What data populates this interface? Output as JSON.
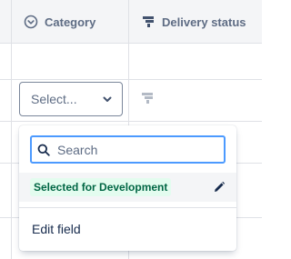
{
  "columns": {
    "category": {
      "label": "Category",
      "icon": "circle-chevron-icon"
    },
    "delivery_status": {
      "label": "Delivery status",
      "icon": "delivery-flag-icon"
    }
  },
  "category_select": {
    "value": "Select...",
    "icon": "chevron-down-icon"
  },
  "dropdown": {
    "search_placeholder": "Search",
    "search_value": "",
    "option_label": "Selected for Development",
    "option_color": "#006644",
    "option_bg": "#e3fcef",
    "edit_label": "Edit field"
  },
  "colors": {
    "focus": "#4c9aff",
    "header_bg": "#f4f5f7",
    "text": "#172b4d",
    "muted": "#5e6c84"
  }
}
